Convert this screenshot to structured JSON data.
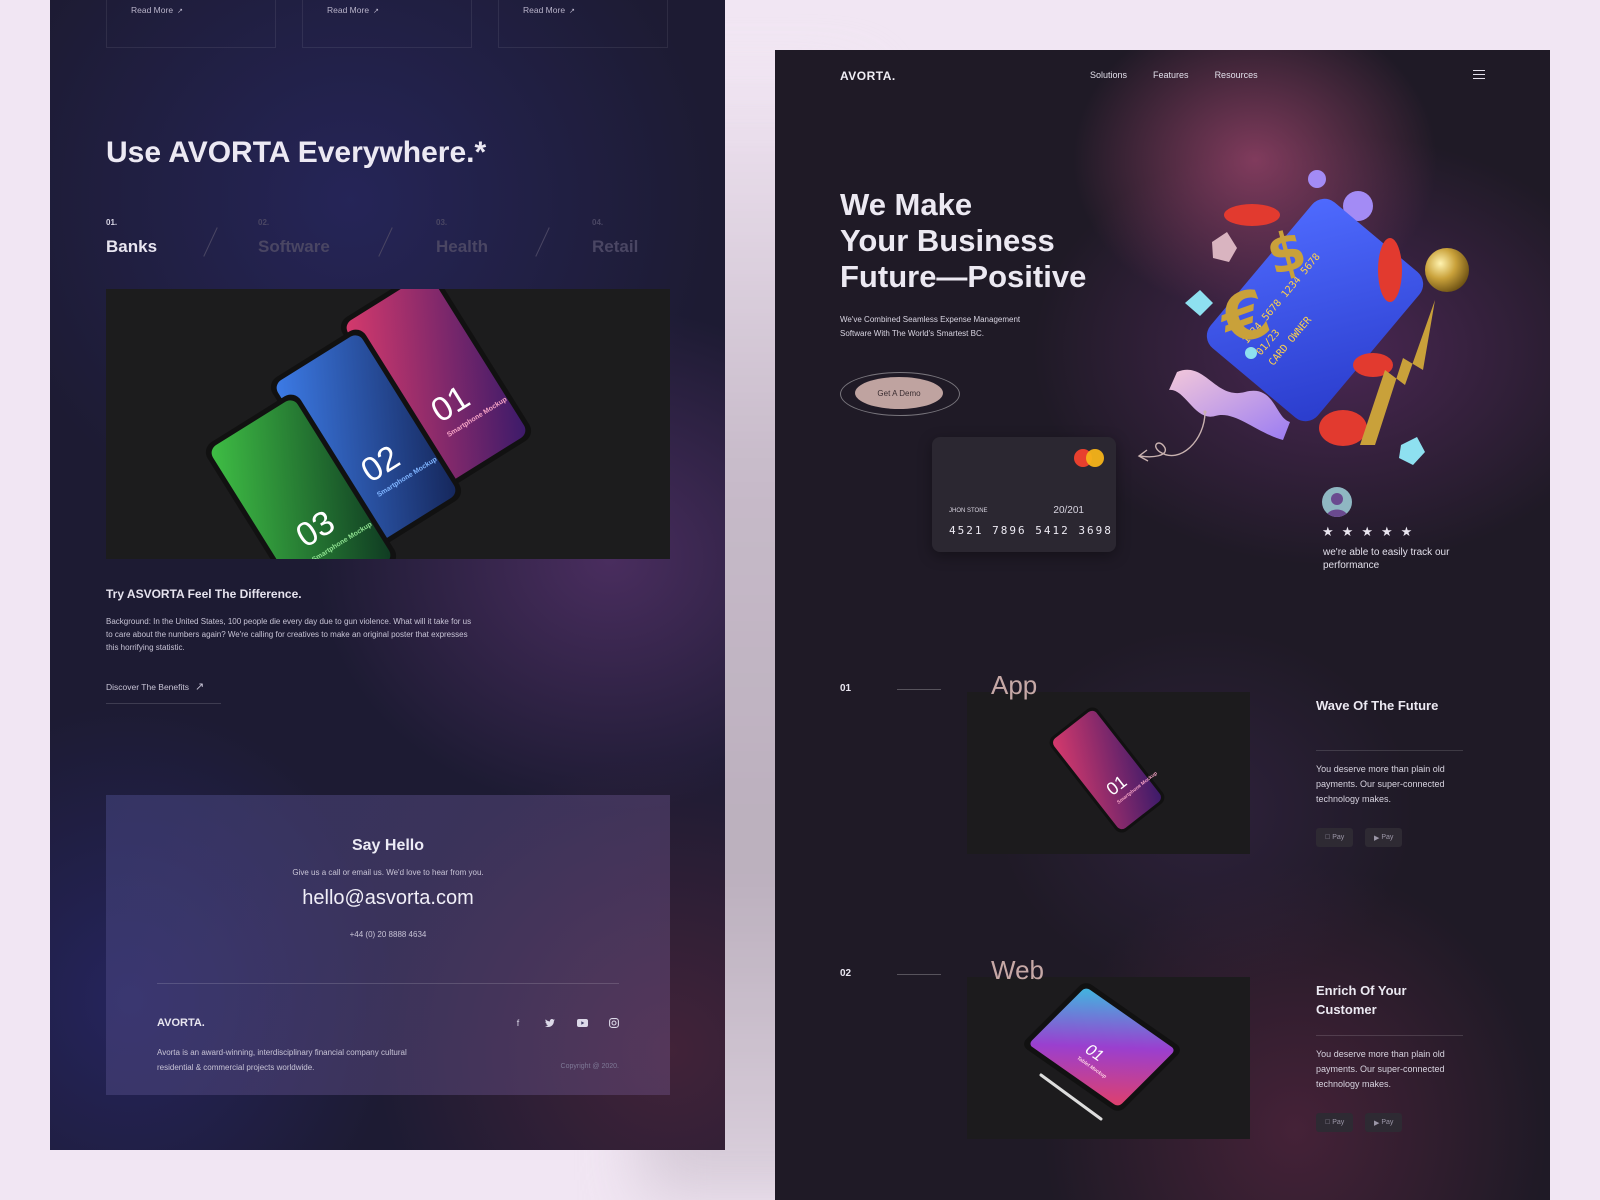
{
  "left": {
    "read_more": [
      "Read More",
      "Read More",
      "Read More"
    ],
    "title": "Use AVORTA Everywhere.*",
    "tabs": [
      {
        "num": "01.",
        "label": "Banks"
      },
      {
        "num": "02.",
        "label": "Software"
      },
      {
        "num": "03.",
        "label": "Health"
      },
      {
        "num": "04.",
        "label": "Retail"
      }
    ],
    "phones": [
      {
        "num": "01",
        "text": "Smartphone Mockup",
        "color": "#c0336a"
      },
      {
        "num": "02",
        "text": "Smartphone Mockup",
        "color": "#2a5fc2"
      },
      {
        "num": "03",
        "text": "Smartphone Mockup",
        "color": "#2f9a3c"
      }
    ],
    "try_title": "Try ASVORTA Feel The Difference.",
    "try_text": "Background: In the United States, 100 people die every day due to gun violence. What will it take for us to care about the numbers again? We're calling for creatives to make an original poster that expresses this horrifying statistic.",
    "discover": "Discover The Benefits",
    "contact": {
      "title": "Say Hello",
      "subtitle": "Give us a call or email us. We'd love to hear from you.",
      "email": "hello@asvorta.com",
      "phone": "+44 (0) 20 8888 4634"
    },
    "footer": {
      "logo": "AVORTA.",
      "text": "Avorta is an award-winning, interdisciplinary financial company cultural residential & commercial projects worldwide.",
      "copyright": "Copyright @ 2020.",
      "socials": [
        "facebook-icon",
        "twitter-icon",
        "youtube-icon",
        "instagram-icon"
      ]
    }
  },
  "right": {
    "logo": "AVORTA.",
    "nav": [
      "Solutions",
      "Features",
      "Resources"
    ],
    "headline": [
      "We Make",
      "Your Business",
      "Future—Positive"
    ],
    "subtitle": "We've Combined Seamless Expense Management Software With The World's Smartest BC.",
    "cta": "Get A Demo",
    "card": {
      "holder": "JHON STONE",
      "expiry": "20/201",
      "number": "4521 7896 5412 3698",
      "card_3d_number": "1234 5678 1234 5678",
      "card_3d_expiry": "01/23",
      "card_3d_owner": "CARD OWNER"
    },
    "review": {
      "stars": 5,
      "star_glyph": "★",
      "text": "we're able to easily track our performance"
    },
    "sections": [
      {
        "num": "01",
        "label": "App",
        "title": "Wave Of The Future",
        "text": "You deserve more than plain old payments. Our super-connected technology makes.",
        "mockup": {
          "num": "01",
          "text": "Smartphone Mockup"
        },
        "pay": [
          "Pay",
          "Pay"
        ]
      },
      {
        "num": "02",
        "label": "Web",
        "title": "Enrich Of Your Customer",
        "text": "You deserve more than plain old payments. Our super-connected technology makes.",
        "mockup": {
          "num": "01",
          "text": "Tablet Mockup"
        },
        "pay": [
          "Pay",
          "Pay"
        ]
      }
    ],
    "colors": {
      "accent": "#bfa3a0",
      "label": "#c6a8a6",
      "bg": "#1f1a26"
    }
  }
}
